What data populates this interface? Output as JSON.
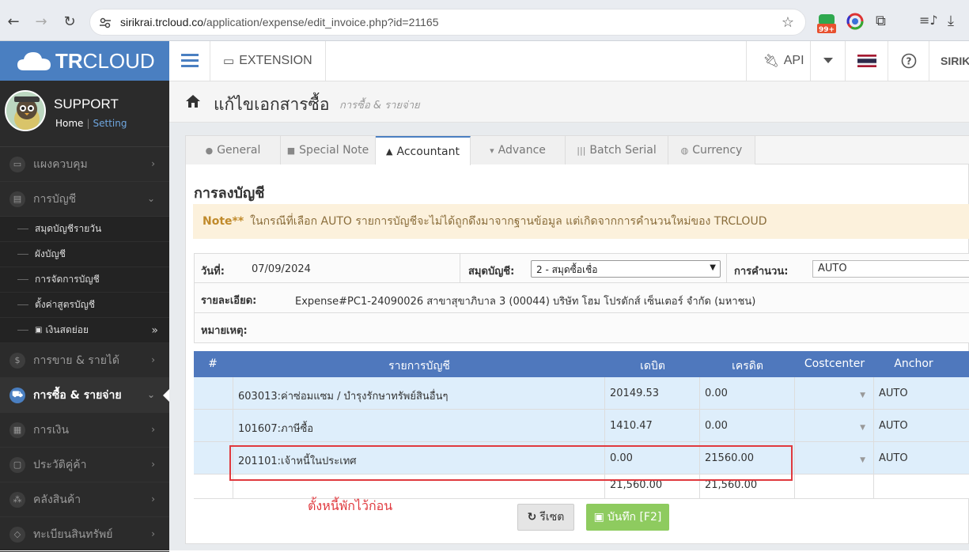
{
  "browser": {
    "url_host": "sirikrai.trcloud.co",
    "url_path": "/application/expense/edit_invoice.php?id=21165",
    "ext_badge": "99+"
  },
  "sidebar": {
    "logo": {
      "bold": "TR",
      "light": "CLOUD"
    },
    "profile": {
      "name": "SUPPORT",
      "home": "Home",
      "setting": "Setting"
    },
    "menu": [
      {
        "label": "แผงควบคุม",
        "icon": "desktop-icon",
        "arrow": "›"
      },
      {
        "label": "การบัญชี",
        "icon": "book-icon",
        "arrow": "⌄"
      },
      {
        "label": "การขาย & รายได้",
        "icon": "dollar-icon",
        "arrow": "›"
      },
      {
        "label": "การซื้อ & รายจ่าย",
        "icon": "cart-icon",
        "arrow": "⌄"
      },
      {
        "label": "การเงิน",
        "icon": "calendar-icon",
        "arrow": "›"
      },
      {
        "label": "ประวัติคู่ค้า",
        "icon": "contact-icon",
        "arrow": "›"
      },
      {
        "label": "คลังสินค้า",
        "icon": "cubes-icon",
        "arrow": "›"
      },
      {
        "label": "ทะเบียนสินทรัพย์",
        "icon": "diamond-icon",
        "arrow": "›"
      }
    ],
    "submenu": [
      {
        "label": "สมุดบัญชีรายวัน"
      },
      {
        "label": "ผังบัญชี"
      },
      {
        "label": "การจัดการบัญชี"
      },
      {
        "label": "ตั้งค่าสูตรบัญชี"
      },
      {
        "label": "เงินสดย่อย",
        "arrow": "»"
      }
    ]
  },
  "topbar": {
    "extension": "EXTENSION",
    "api": "API",
    "user": "SIRIK"
  },
  "page": {
    "title": "แก้ไขเอกสารซื้อ",
    "subtitle": "การซื้อ & รายจ่าย"
  },
  "tabs": [
    {
      "label": "General",
      "icon": "user-icon"
    },
    {
      "label": "Special Note",
      "icon": "note-icon"
    },
    {
      "label": "Accountant",
      "icon": "graduation-icon"
    },
    {
      "label": "Advance",
      "icon": "download-icon"
    },
    {
      "label": "Batch Serial",
      "icon": "barcode-icon"
    },
    {
      "label": "Currency",
      "icon": "globe-icon"
    }
  ],
  "section_title": "การลงบัญชี",
  "note": {
    "prefix": "Note**",
    "text": "ในกรณีที่เลือก AUTO รายการบัญชีจะไม่ได้ถูกดึงมาจากฐานข้อมูล แต่เกิดจากการคำนวนใหม่ของ TRCLOUD"
  },
  "form": {
    "date_label": "วันที่:",
    "date_value": "07/09/2024",
    "journal_label": "สมุดบัญชี:",
    "journal_value": "2 - สมุดซื้อเชื่อ",
    "calc_label": "การคำนวน:",
    "calc_value": "AUTO",
    "detail_label": "รายละเอียด:",
    "detail_value": "Expense#PC1-24090026 สาขาสุขาภิบาล 3 (00044) บริษัท โฮม โปรดักส์ เซ็นเตอร์ จำกัด (มหาชน)",
    "remark_label": "หมายเหตุ:"
  },
  "table": {
    "headers": [
      "#",
      "รายการบัญชี",
      "เดบิต",
      "เครดิต",
      "Costcenter",
      "Anchor"
    ],
    "rows": [
      {
        "account": "603013:ค่าซ่อมแซม / บำรุงรักษาทรัพย์สินอื่นๆ",
        "debit": "20149.53",
        "credit": "0.00",
        "anchor": "AUTO"
      },
      {
        "account": "101607:ภาษีซื้อ",
        "debit": "1410.47",
        "credit": "0.00",
        "anchor": "AUTO"
      },
      {
        "account": "201101:เจ้าหนี้ในประเทศ",
        "debit": "0.00",
        "credit": "21560.00",
        "anchor": "AUTO"
      }
    ],
    "total_debit": "21,560.00",
    "total_credit": "21,560.00"
  },
  "annotation": "ตั้งหนี้พักไว้ก่อน",
  "buttons": {
    "reset": "รีเซต",
    "save": "บันทึก [F2]"
  },
  "colors": {
    "brand": "#4a7fc1",
    "sidebar": "#2b2b2b",
    "header_row": "#4f78bd",
    "highlight": "#e0393e",
    "save": "#8ecb5f"
  }
}
